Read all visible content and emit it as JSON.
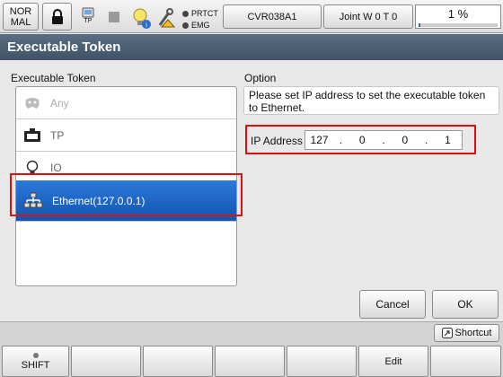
{
  "statusbar": {
    "mode_line1": "NOR",
    "mode_line2": "MAL",
    "tp_label": "TP",
    "lamps": [
      {
        "label": "PRTCT"
      },
      {
        "label": "EMG"
      }
    ],
    "program": "CVR038A1",
    "joint": "Joint  W 0 T 0",
    "speed": "1 %",
    "speed_fraction": 0.01
  },
  "title": "Executable Token",
  "token_list": {
    "heading": "Executable Token",
    "items": [
      {
        "label": "Any",
        "icon": "gamepad-icon",
        "state": "disabled"
      },
      {
        "label": "TP",
        "icon": "teach-pendant-icon",
        "state": "normal"
      },
      {
        "label": "IO",
        "icon": "lightbulb-icon",
        "state": "normal"
      },
      {
        "label": "Ethernet(127.0.0.1)",
        "icon": "network-icon",
        "state": "selected"
      }
    ]
  },
  "option": {
    "heading": "Option",
    "message": "Please set IP address to set the executable token to Ethernet.",
    "ip_label": "IP Address",
    "ip": [
      "127",
      "0",
      "0",
      "1"
    ],
    "sep": "."
  },
  "buttons": {
    "cancel": "Cancel",
    "ok": "OK",
    "shortcut": "Shortcut"
  },
  "fkeys": [
    "SHIFT",
    "",
    "",
    "",
    "",
    "Edit",
    ""
  ],
  "colors": {
    "title_bg": "#4a5d72",
    "selected_bg": "#1e67c6",
    "highlight": "#e01010"
  }
}
